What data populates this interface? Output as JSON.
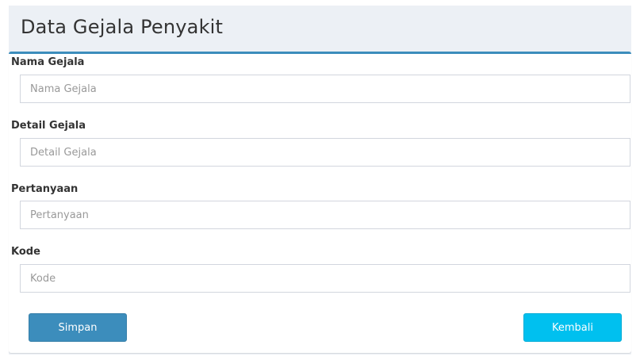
{
  "header": {
    "title": "Data Gejala Penyakit"
  },
  "form": {
    "fields": [
      {
        "label": "Nama Gejala",
        "placeholder": "Nama Gejala",
        "value": ""
      },
      {
        "label": "Detail Gejala",
        "placeholder": "Detail Gejala",
        "value": ""
      },
      {
        "label": "Pertanyaan",
        "placeholder": "Pertanyaan",
        "value": ""
      },
      {
        "label": "Kode",
        "placeholder": "Kode",
        "value": ""
      }
    ],
    "save_label": "Simpan",
    "back_label": "Kembali"
  },
  "colors": {
    "accent": "#3c8dbc",
    "info": "#00c0ef",
    "background": "#ecf0f5"
  }
}
